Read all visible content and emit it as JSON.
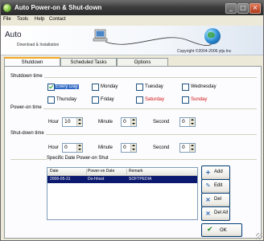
{
  "window": {
    "title": "Auto Power-on & Shut-down",
    "controls": {
      "minimize": "_",
      "maximize": "□",
      "close": "×"
    }
  },
  "menu": {
    "items": [
      "File",
      "Tools",
      "Help",
      "Contact"
    ]
  },
  "header": {
    "app_short": "Auto",
    "subtitle": "Download & Installation",
    "copyright": "Copyright ©2004-2006 ytjs.Inc"
  },
  "tabs": [
    "Shutdown",
    "Scheduled Tasks",
    "Options"
  ],
  "week": {
    "title": "Shutdown time",
    "days": [
      {
        "label": "Every Day",
        "checked": true,
        "color": "#000000",
        "selected": true
      },
      {
        "label": "Monday",
        "checked": false,
        "color": "#000000"
      },
      {
        "label": "Tuesday",
        "checked": false,
        "color": "#000000"
      },
      {
        "label": "Wednesday",
        "checked": false,
        "color": "#000000"
      },
      {
        "label": "Thursday",
        "checked": false,
        "color": "#000000"
      },
      {
        "label": "Friday",
        "checked": false,
        "color": "#000000"
      },
      {
        "label": "Saturday",
        "checked": false,
        "color": "#d01010"
      },
      {
        "label": "Sunday",
        "checked": false,
        "color": "#d01010"
      }
    ]
  },
  "poweron": {
    "title": "Power-on time",
    "hour_label": "Hour",
    "hour": "10",
    "minute_label": "Minute",
    "minute": "0",
    "second_label": "Second",
    "second": "0"
  },
  "shutdown": {
    "title": "Shut-down time",
    "hour_label": "Hour",
    "hour": "0",
    "minute_label": "Minute",
    "minute": "0",
    "second_label": "Second",
    "second": "0"
  },
  "specific": {
    "title": "Specific Date Power-on Shut",
    "columns": [
      "Date",
      "Power-on Date",
      "Remark"
    ],
    "rows": [
      {
        "date": "2006-05-31",
        "power": "Do-hhost",
        "remark": "SOFTPEDIA"
      }
    ]
  },
  "buttons": {
    "add": "Add",
    "edit": "Edit",
    "del": "Del",
    "delall": "Del All",
    "ok": "OK"
  },
  "colors": {
    "accent_tab": "#f5a623",
    "selection": "#0b1a6e",
    "weekend": "#d01010"
  }
}
